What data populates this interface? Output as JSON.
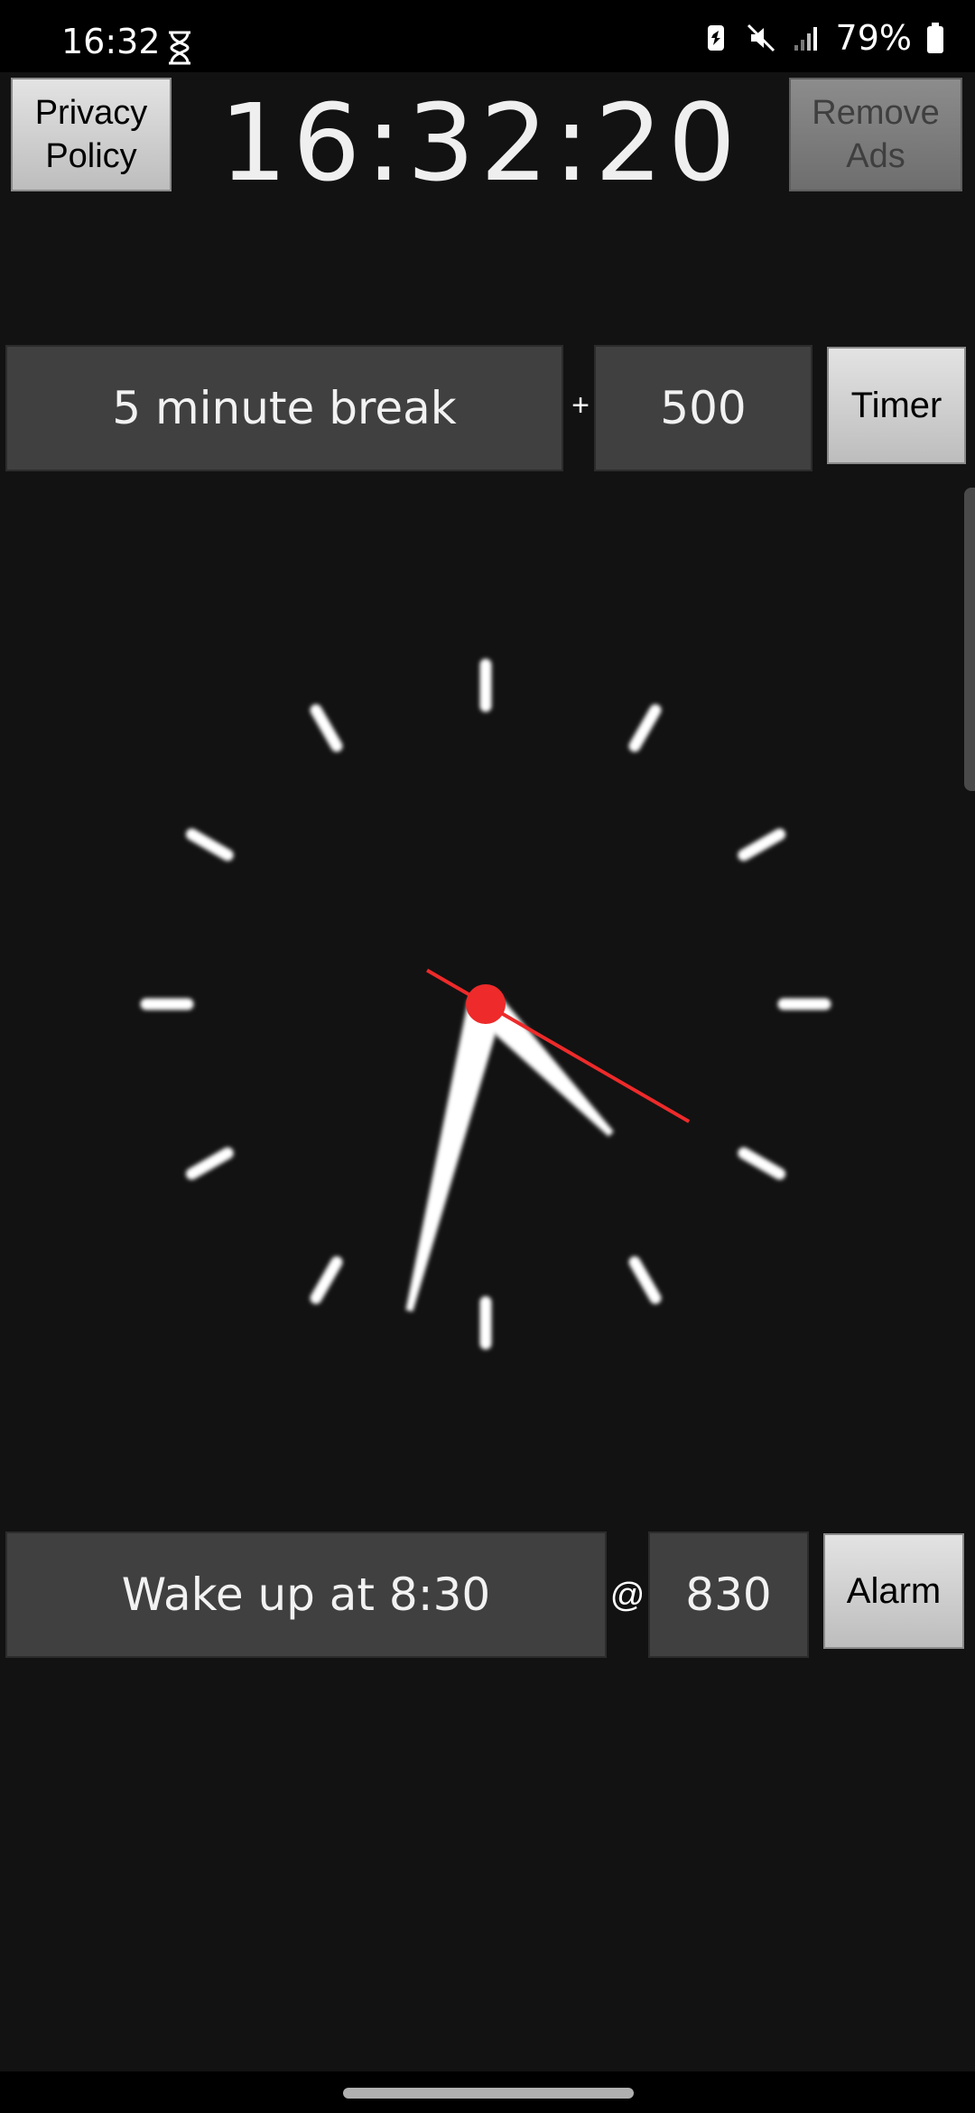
{
  "status_bar": {
    "time": "16:32",
    "battery_percent": "79%",
    "icons": [
      "hourglass-icon",
      "battery-saver-icon",
      "mute-icon",
      "signal-icon",
      "battery-icon"
    ]
  },
  "header": {
    "privacy_button": "Privacy Policy",
    "digital_time": "16:32:20",
    "remove_ads_button": "Remove Ads"
  },
  "timer": {
    "label": "5 minute break",
    "separator": "+",
    "value": "500",
    "button": "Timer"
  },
  "analog_clock": {
    "hour": 16,
    "minute": 32,
    "second": 20,
    "colors": {
      "hands": "#ffffff",
      "second_hand": "#ee2a2a",
      "ticks": "#ffffff"
    }
  },
  "alarm": {
    "label": "Wake up at 8:30",
    "separator": "@",
    "value": "830",
    "button": "Alarm"
  }
}
